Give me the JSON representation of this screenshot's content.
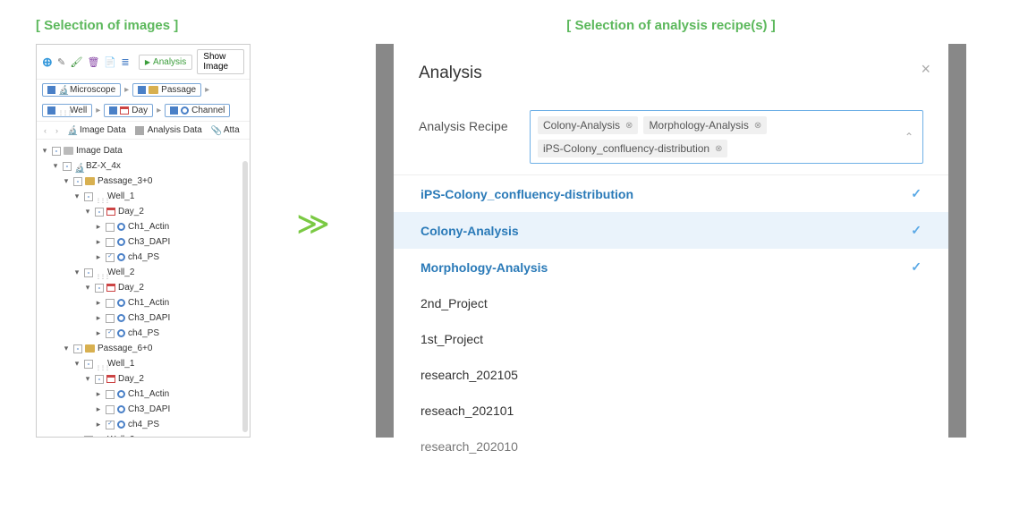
{
  "left": {
    "title": "[ Selection of images ]",
    "toolbar": {
      "analysis": "Analysis",
      "show_image": "Show Image"
    },
    "crumbs1": {
      "microscope": "Microscope",
      "passage": "Passage"
    },
    "crumbs2": {
      "well": "Well",
      "day": "Day",
      "channel": "Channel"
    },
    "tabs": {
      "image_data": "Image Data",
      "analysis_data": "Analysis Data",
      "atta": "Atta"
    },
    "tree": {
      "root": "Image Data",
      "bz": "BZ-X_4x",
      "p1": "Passage_3+0",
      "p2": "Passage_6+0",
      "w1": "Well_1",
      "w2": "Well_2",
      "day": "Day_2",
      "ch1": "Ch1_Actin",
      "ch3": "Ch3_DAPI",
      "ch4": "ch4_PS"
    }
  },
  "right": {
    "title": "[ Selection of analysis recipe(s) ]",
    "modal_title": "Analysis",
    "field_label": "Analysis Recipe",
    "selected": {
      "t1": "Colony-Analysis",
      "t2": "Morphology-Analysis",
      "t3": "iPS-Colony_confluency-distribution"
    },
    "options": {
      "o1": "iPS-Colony_confluency-distribution",
      "o2": "Colony-Analysis",
      "o3": "Morphology-Analysis",
      "o4": "2nd_Project",
      "o5": "1st_Project",
      "o6": "research_202105",
      "o7": "reseach_202101",
      "o8": "research_202010"
    }
  }
}
